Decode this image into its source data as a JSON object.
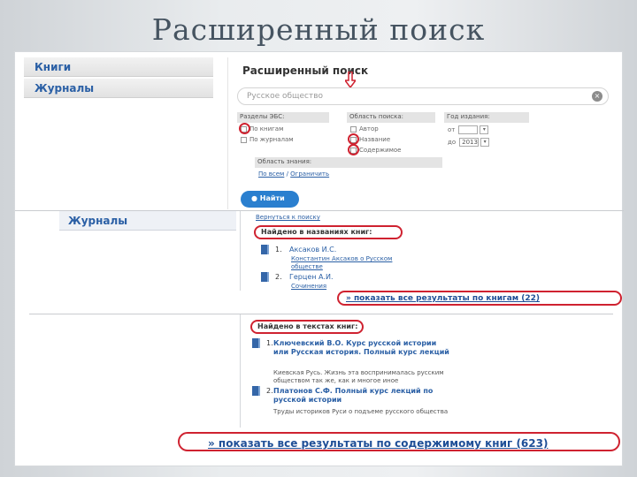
{
  "slide": {
    "title": "Расширенный поиск"
  },
  "sidebar": {
    "books_label": "Книги",
    "journals_label": "Журналы"
  },
  "search_panel": {
    "title": "Расширенный поиск",
    "query": "Русское общество",
    "clear_symbol": "×",
    "groups": [
      {
        "head": "Разделы ЭБС:",
        "options": [
          "По книгам",
          "По журналам"
        ]
      },
      {
        "head": "Область поиска:",
        "options": [
          "Автор",
          "Название",
          "Содержимое"
        ]
      },
      {
        "head": "Год издания:",
        "from_label": "от",
        "to_label": "до",
        "to_value": "2013"
      }
    ],
    "knowledge_head": "Область знания:",
    "knowledge_all": "По всем",
    "knowledge_sep": "/",
    "knowledge_limit": "Ограничить",
    "find_button": "Найти",
    "find_icon": "search-icon"
  },
  "results": {
    "journals_label": "Журналы",
    "back_link": "Вернуться к поиску",
    "books_heading": "Найдено в названиях книг:",
    "book_results": [
      {
        "num": "1.",
        "author": "Аксаков И.С.",
        "title": "Константин Аксаков о Русском обществе"
      },
      {
        "num": "2.",
        "author": "Герцен А.И.",
        "title": "Сочинения"
      }
    ],
    "show_books": "» показать все результаты по книгам (22)",
    "texts_heading": "Найдено в текстах книг:",
    "text_results": [
      {
        "num": "1.",
        "title": "Ключевский В.О. Курс русской истории или Русская история. Полный курс лекций",
        "snippet": "Киевская Русь. Жизнь эта воспринималась русским обществом так же, как и многое иное"
      },
      {
        "num": "2.",
        "title": "Платонов С.Ф. Полный курс лекций по русской истории",
        "snippet": "Труды историков Руси о подъеме русского общества"
      }
    ],
    "show_texts": "» показать все результаты по содержимому книг (623)"
  },
  "colors": {
    "accent": "#2a5fa5",
    "button": "#2a7fcf",
    "highlight": "#cf2230"
  }
}
